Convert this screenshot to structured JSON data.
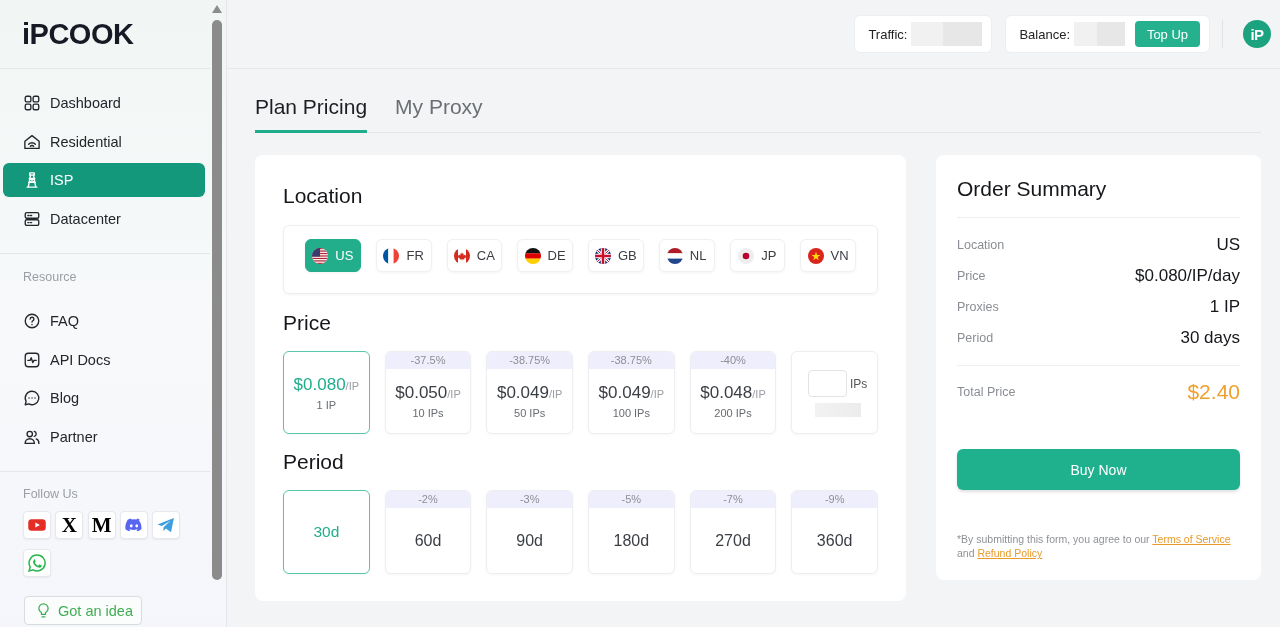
{
  "sidebar": {
    "logo": "iPCOOK",
    "main_nav": [
      {
        "label": "Dashboard",
        "selected": false
      },
      {
        "label": "Residential",
        "selected": false
      },
      {
        "label": "ISP",
        "selected": true
      },
      {
        "label": "Datacenter",
        "selected": false
      }
    ],
    "resource_heading": "Resource",
    "resource_nav": [
      {
        "label": "FAQ",
        "selected": false
      },
      {
        "label": "API Docs",
        "selected": false
      },
      {
        "label": "Blog",
        "selected": false
      },
      {
        "label": "Partner",
        "selected": false
      }
    ],
    "follow_heading": "Follow Us",
    "social_links": [
      {
        "kind": "icon"
      },
      {
        "kind": "glyph",
        "text": "X"
      },
      {
        "kind": "glyph",
        "text": "M"
      },
      {
        "kind": "icon"
      },
      {
        "kind": "icon"
      },
      {
        "kind": "icon"
      }
    ],
    "idea_button": "Got an idea"
  },
  "top_bar": {
    "traffic_label": "Traffic:",
    "balance_label": "Balance:",
    "top_up_button": "Top Up",
    "avatar": "iP"
  },
  "tabs": [
    {
      "label": "Plan Pricing",
      "selected": true
    },
    {
      "label": "My Proxy",
      "selected": false
    }
  ],
  "plan": {
    "location_heading": "Location",
    "countries": [
      {
        "code": "US",
        "selected": true
      },
      {
        "code": "FR",
        "selected": false
      },
      {
        "code": "CA",
        "selected": false
      },
      {
        "code": "DE",
        "selected": false
      },
      {
        "code": "GB",
        "selected": false
      },
      {
        "code": "NL",
        "selected": false
      },
      {
        "code": "JP",
        "selected": false
      },
      {
        "code": "VN",
        "selected": false
      }
    ],
    "price_heading": "Price",
    "price_options": [
      {
        "kind": "preset",
        "price": "$0.080",
        "unit": "/IP",
        "quantity": "1 IP",
        "selected": true
      },
      {
        "kind": "preset",
        "discount": "-37.5%",
        "price": "$0.050",
        "unit": "/IP",
        "quantity": "10 IPs",
        "selected": false
      },
      {
        "kind": "preset",
        "discount": "-38.75%",
        "price": "$0.049",
        "unit": "/IP",
        "quantity": "50 IPs",
        "selected": false
      },
      {
        "kind": "preset",
        "discount": "-38.75%",
        "price": "$0.049",
        "unit": "/IP",
        "quantity": "100 IPs",
        "selected": false
      },
      {
        "kind": "preset",
        "discount": "-40%",
        "price": "$0.048",
        "unit": "/IP",
        "quantity": "200 IPs",
        "selected": false
      },
      {
        "kind": "custom",
        "unit_label": "IPs",
        "selected": false
      }
    ],
    "period_heading": "Period",
    "period_options": [
      {
        "label": "30d",
        "selected": true
      },
      {
        "discount": "-2%",
        "label": "60d",
        "selected": false
      },
      {
        "discount": "-3%",
        "label": "90d",
        "selected": false
      },
      {
        "discount": "-5%",
        "label": "180d",
        "selected": false
      },
      {
        "discount": "-7%",
        "label": "270d",
        "selected": false
      },
      {
        "discount": "-9%",
        "label": "360d",
        "selected": false
      }
    ]
  },
  "order_summary": {
    "heading": "Order Summary",
    "rows": [
      {
        "label": "Location",
        "value": "US"
      },
      {
        "label": "Price",
        "value": "$0.080/IP/day"
      },
      {
        "label": "Proxies",
        "value": "1 IP"
      },
      {
        "label": "Period",
        "value": "30 days"
      }
    ],
    "total_label": "Total Price",
    "total_value": "$2.40",
    "buy_button": "Buy Now",
    "disclaimer": "*By submitting this form, you agree to our",
    "terms_link": "Terms of Service",
    "disclaimer_and": "and",
    "refund_link": "Refund Policy"
  }
}
